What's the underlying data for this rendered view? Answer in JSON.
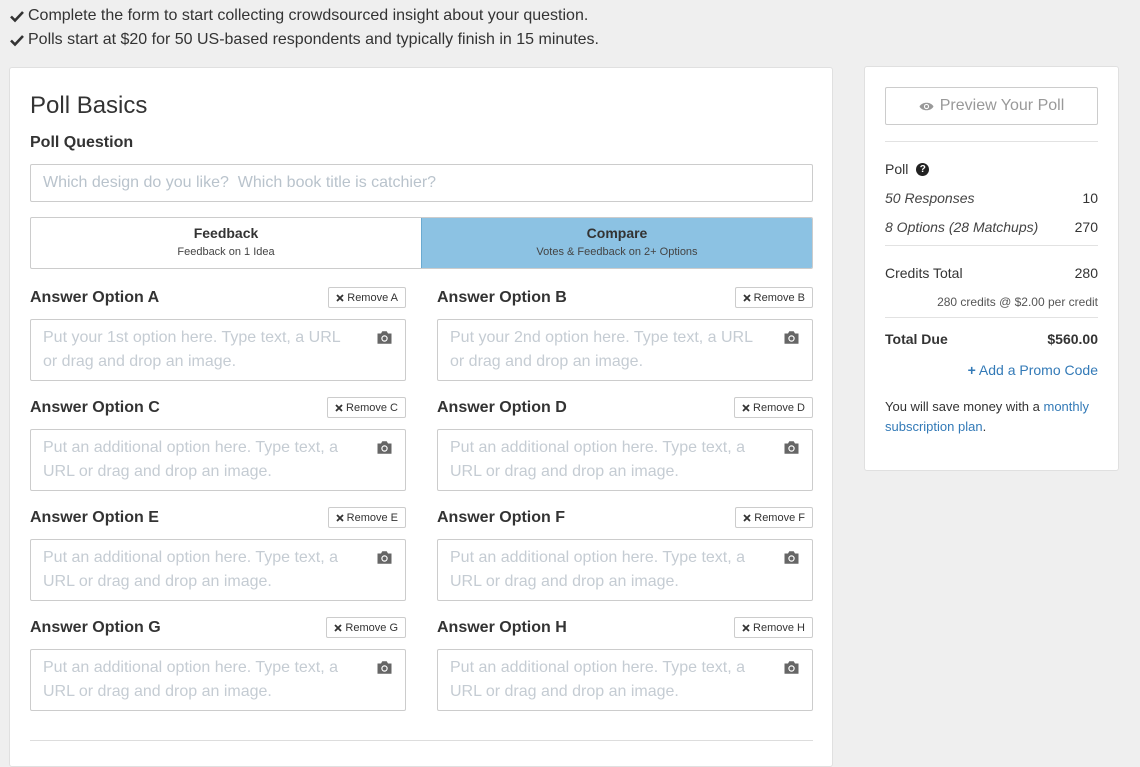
{
  "intro": {
    "line1": "Complete the form to start collecting crowdsourced insight about your question.",
    "line2": "Polls start at $20 for 50 US-based respondents and typically finish in 15 minutes."
  },
  "form": {
    "title": "Poll Basics",
    "question_label": "Poll Question",
    "question_placeholder": "Which design do you like?  Which book title is catchier?",
    "mode": {
      "feedback_title": "Feedback",
      "feedback_sub": "Feedback on 1 Idea",
      "compare_title": "Compare",
      "compare_sub": "Votes & Feedback on 2+ Options",
      "selected": "Compare"
    },
    "answers": [
      {
        "label": "Answer Option A",
        "remove": "Remove A",
        "placeholder": "Put your 1st option here. Type text, a URL or drag and drop an image."
      },
      {
        "label": "Answer Option B",
        "remove": "Remove B",
        "placeholder": "Put your 2nd option here. Type text, a URL or drag and drop an image."
      },
      {
        "label": "Answer Option C",
        "remove": "Remove C",
        "placeholder": "Put an additional option here. Type text, a URL or drag and drop an image."
      },
      {
        "label": "Answer Option D",
        "remove": "Remove D",
        "placeholder": "Put an additional option here. Type text, a URL or drag and drop an image."
      },
      {
        "label": "Answer Option E",
        "remove": "Remove E",
        "placeholder": "Put an additional option here. Type text, a URL or drag and drop an image."
      },
      {
        "label": "Answer Option F",
        "remove": "Remove F",
        "placeholder": "Put an additional option here. Type text, a URL or drag and drop an image."
      },
      {
        "label": "Answer Option G",
        "remove": "Remove G",
        "placeholder": "Put an additional option here. Type text, a URL or drag and drop an image."
      },
      {
        "label": "Answer Option H",
        "remove": "Remove H",
        "placeholder": "Put an additional option here. Type text, a URL or drag and drop an image."
      }
    ]
  },
  "summary": {
    "preview_label": "Preview Your Poll",
    "poll_label": "Poll",
    "help_glyph": "?",
    "responses_label": "50 Responses",
    "responses_value": "10",
    "options_label": "8 Options (28 Matchups)",
    "options_value": "270",
    "credits_label": "Credits Total",
    "credits_value": "280",
    "credits_note": "280 credits @ $2.00 per credit",
    "total_label": "Total Due",
    "total_value": "$560.00",
    "promo_plus": "+",
    "promo_label": "Add a Promo Code",
    "save_text": "You will save money with a ",
    "save_link": "monthly subscription plan",
    "save_end": "."
  },
  "colors": {
    "accent_selected": "#8cc2e3",
    "link": "#337ab7"
  },
  "icons": [
    "check-icon",
    "remove-x-icon",
    "camera-icon",
    "eye-icon",
    "question-circle-icon"
  ]
}
